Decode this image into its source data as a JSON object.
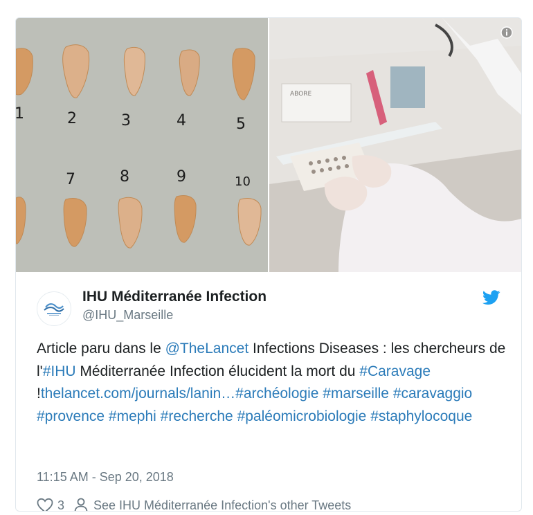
{
  "tweet": {
    "display_name": "IHU Méditerranée Infection",
    "handle": "@IHU_Marseille",
    "text": [
      {
        "t": "Article paru dans le ",
        "link": false
      },
      {
        "t": "@TheLancet",
        "link": true
      },
      {
        "t": " Infections Diseases : les chercheurs de l'",
        "link": false
      },
      {
        "t": "#IHU",
        "link": true
      },
      {
        "t": " Méditerranée Infection élucident la mort du ",
        "link": false
      },
      {
        "t": "#Caravage",
        "link": true
      },
      {
        "t": " !",
        "link": false
      },
      {
        "t": "thelancet.com/journals/lanin…",
        "link": true
      },
      {
        "t": "#archéologie",
        "link": true
      },
      {
        "t": " ",
        "link": false
      },
      {
        "t": "#marseille",
        "link": true
      },
      {
        "t": " ",
        "link": false
      },
      {
        "t": "#caravaggio",
        "link": true
      },
      {
        "t": " ",
        "link": false
      },
      {
        "t": "#provence",
        "link": true
      },
      {
        "t": " ",
        "link": false
      },
      {
        "t": "#mephi",
        "link": true
      },
      {
        "t": " ",
        "link": false
      },
      {
        "t": "#recherche",
        "link": true
      },
      {
        "t": " ",
        "link": false
      },
      {
        "t": "#paléomicrobiologie",
        "link": true
      },
      {
        "t": " ",
        "link": false
      },
      {
        "t": "#staphylocoque",
        "link": true
      }
    ],
    "timestamp": "11:15 AM - Sep 20, 2018",
    "likes": "3",
    "other_tweets_link": "See IHU Méditerranée Infection's other Tweets"
  },
  "media": {
    "tooth_numbers_top": [
      "1",
      "2",
      "3",
      "4",
      "5"
    ],
    "tooth_numbers_bottom": [
      "7",
      "8",
      "9",
      "10"
    ],
    "box_label": "ABORE"
  },
  "icons": {
    "info": "info-icon",
    "brand": "twitter-bird-icon",
    "like": "heart-icon",
    "profile": "person-icon"
  },
  "colors": {
    "link": "#2b7bb9",
    "twitter_blue": "#1da1f2",
    "secondary_text": "#697882",
    "border": "#e1e8ed"
  }
}
